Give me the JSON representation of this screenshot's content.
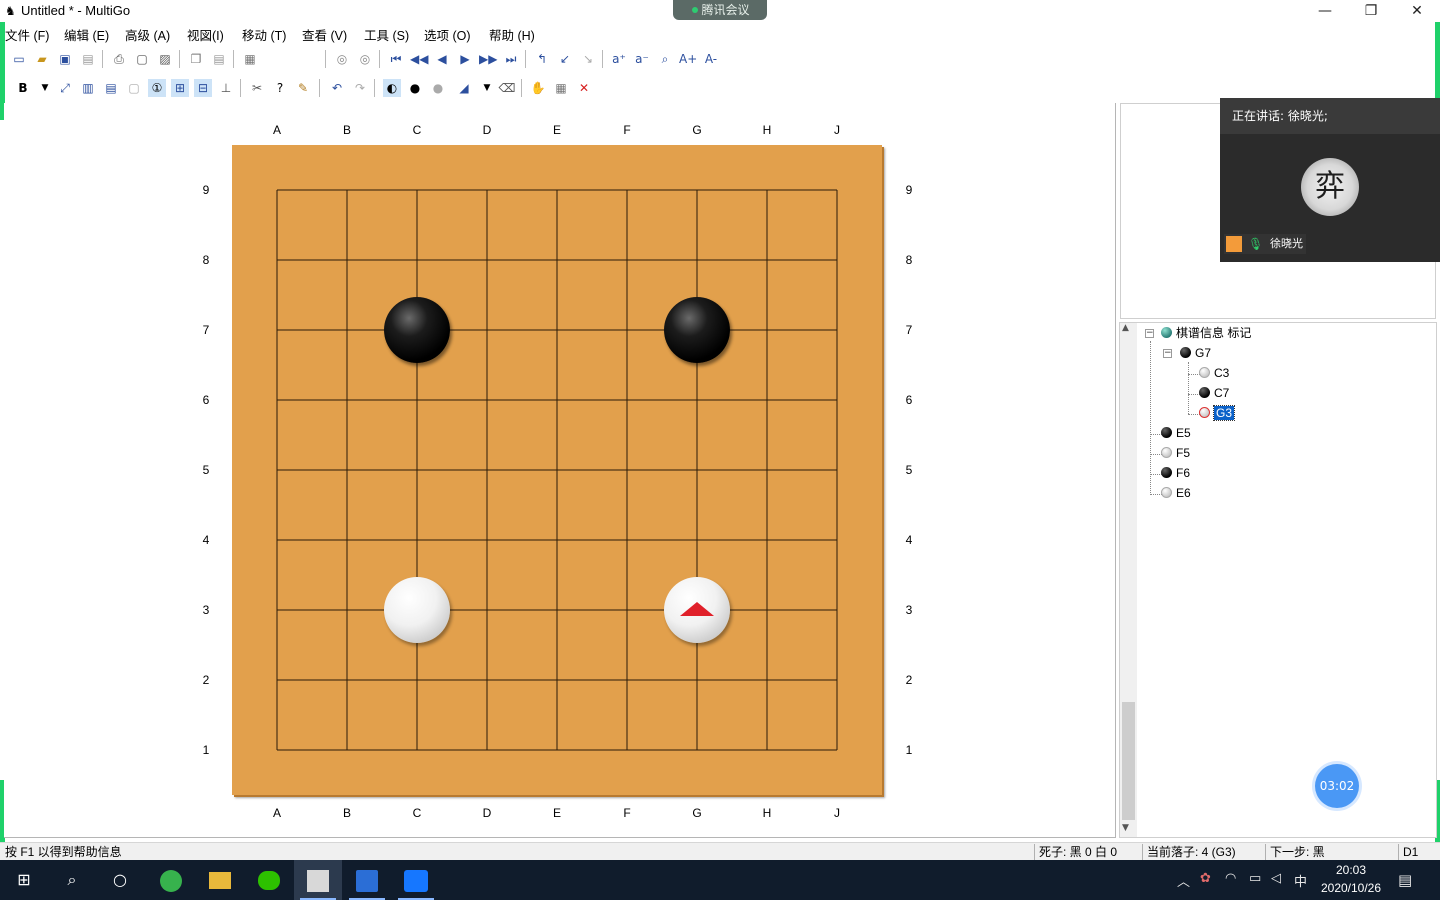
{
  "window": {
    "title": "Untitled  * - MultiGo",
    "minimize": "—",
    "restore": "❐",
    "close": "✕"
  },
  "meeting": {
    "app_label": "腾讯会议",
    "speaker_text": "正在讲话: 徐晓光;",
    "avatar_char": "弈",
    "user_name": "徐晓光",
    "timer": "03:02"
  },
  "menu": [
    "文件 (F)",
    "编辑 (E)",
    "高级 (A)",
    "视図(I)",
    "移动 (T)",
    "查看 (V)",
    "工具 (S)",
    "选项 (O)",
    "帮助 (H)"
  ],
  "toolbar1": [
    "new-file-icon",
    "open-folder-icon",
    "save-icon",
    "save-as-icon",
    "print-icon",
    "print-preview-icon",
    "export-image-icon",
    "copy-icon",
    "paste-icon",
    "properties-icon",
    "prev-game-icon",
    "next-game-icon",
    "first-move-icon",
    "back-ten-icon",
    "back-one-icon",
    "forward-one-icon",
    "forward-ten-icon",
    "last-move-icon",
    "back-to-main-icon",
    "prev-variation-icon",
    "next-variation-icon",
    "mark-a-icon",
    "mark-b-icon",
    "find-icon",
    "zoom-in-icon",
    "zoom-out-icon"
  ],
  "toolbar2": [
    "black-first-icon",
    "dropdown-icon",
    "rotate-icon",
    "coord-icon",
    "layout-icon",
    "blank-icon",
    "move-number-icon",
    "tree-view-icon",
    "branch-view-icon",
    "hierarchy-icon",
    "tools-icon",
    "hint-icon",
    "brush-icon",
    "undo-icon",
    "redo-icon",
    "alternate-play-icon",
    "black-stone-icon",
    "white-stone-icon",
    "marker-icon",
    "marker-dropdown-icon",
    "eraser-icon",
    "hand-icon",
    "edit-icon",
    "delete-icon"
  ],
  "board": {
    "columns": [
      "A",
      "B",
      "C",
      "D",
      "E",
      "F",
      "G",
      "H",
      "J"
    ],
    "rows": [
      "9",
      "8",
      "7",
      "6",
      "5",
      "4",
      "3",
      "2",
      "1"
    ],
    "stones": [
      {
        "point": "C7",
        "color": "black"
      },
      {
        "point": "G7",
        "color": "black"
      },
      {
        "point": "C3",
        "color": "white"
      },
      {
        "point": "G3",
        "color": "white",
        "marker": "triangle"
      }
    ]
  },
  "tree": {
    "root_label": "棋谱信息 标记",
    "nodes": [
      {
        "label": "G7",
        "color": "black"
      },
      {
        "label": "C3",
        "color": "white"
      },
      {
        "label": "C7",
        "color": "black"
      },
      {
        "label": "G3",
        "color": "white",
        "selected": true
      },
      {
        "label": "E5",
        "color": "black"
      },
      {
        "label": "F5",
        "color": "white"
      },
      {
        "label": "F6",
        "color": "black"
      },
      {
        "label": "E6",
        "color": "white"
      }
    ],
    "expand_symbol": "−"
  },
  "status": {
    "help": "按 F1 以得到帮助信息",
    "captures": "死子: 黑 0 白 0",
    "current_move": "当前落子: 4 (G3)",
    "next_move": "下一步: 黑",
    "level": "D1"
  },
  "taskbar": {
    "start": "⊞",
    "search": "⌕",
    "task_view": "○",
    "apps": [
      "browser-icon",
      "file-explorer-icon",
      "wechat-icon",
      "multigo-icon",
      "word-icon",
      "meeting-icon"
    ],
    "tray_ime": "中",
    "time": "20:03",
    "date": "2020/10/26",
    "notification": "▤"
  },
  "colors": {
    "board_wood": "#e2a04c",
    "meeting_green": "#1fd16a",
    "marker_red": "#e0202a",
    "selection_blue": "#0c62c9",
    "taskbar_bg": "#101c2c"
  }
}
